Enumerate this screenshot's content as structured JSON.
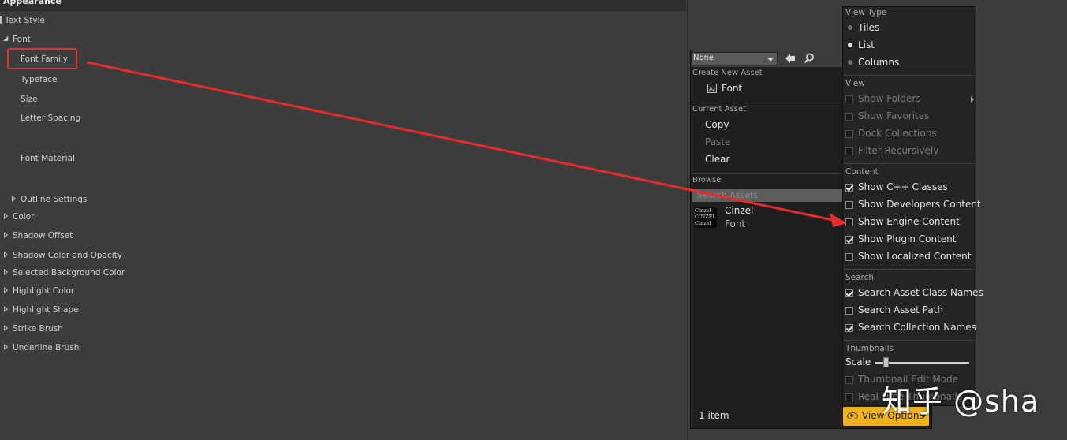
{
  "details": {
    "section_title": "Appearance",
    "props": {
      "text_style": "Text Style",
      "font": "Font",
      "font_family": "Font Family",
      "typeface": "Typeface",
      "size": "Size",
      "letter_spacing": "Letter Spacing",
      "font_material": "Font Material",
      "outline_settings": "Outline Settings",
      "color": "Color",
      "shadow_offset": "Shadow Offset",
      "shadow_color": "Shadow Color and Opacity",
      "selected_bg": "Selected Background Color",
      "highlight_color": "Highlight Color",
      "highlight_shape": "Highlight Shape",
      "strike_brush": "Strike Brush",
      "underline_brush": "Underline Brush"
    }
  },
  "picker": {
    "combo_value": "None",
    "create_new_asset": "Create New Asset",
    "create_font": "Font",
    "current_asset": "Current Asset",
    "copy": "Copy",
    "paste": "Paste",
    "clear": "Clear",
    "browse": "Browse",
    "search_placeholder": "Search Assets",
    "asset_name": "Cinzel",
    "asset_type": "Font",
    "thumb_lines": [
      "Cinzel",
      "CINZEL",
      "Cinzel"
    ],
    "item_count": "1 item"
  },
  "view_options": {
    "view_type": "View Type",
    "tiles": "Tiles",
    "list": "List",
    "columns": "Columns",
    "view": "View",
    "show_folders": "Show Folders",
    "show_favorites": "Show Favorites",
    "dock_collections": "Dock Collections",
    "filter_recursively": "Filter Recursively",
    "content": "Content",
    "show_cpp": "Show C++ Classes",
    "show_dev": "Show Developers Content",
    "show_engine": "Show Engine Content",
    "show_plugin": "Show Plugin Content",
    "show_localized": "Show Localized Content",
    "search": "Search",
    "search_class": "Search Asset Class Names",
    "search_path": "Search Asset Path",
    "search_collection": "Search Collection Names",
    "thumbnails": "Thumbnails",
    "scale": "Scale",
    "scale_value": 0.12,
    "thumb_edit": "Thumbnail Edit Mode",
    "realtime_thumbs": "Real-Time Thumbnails",
    "button_label": "View Options"
  },
  "watermark": "知乎 @sha",
  "colors": {
    "accent": "#f0b21d",
    "annotation": "#e03030"
  }
}
